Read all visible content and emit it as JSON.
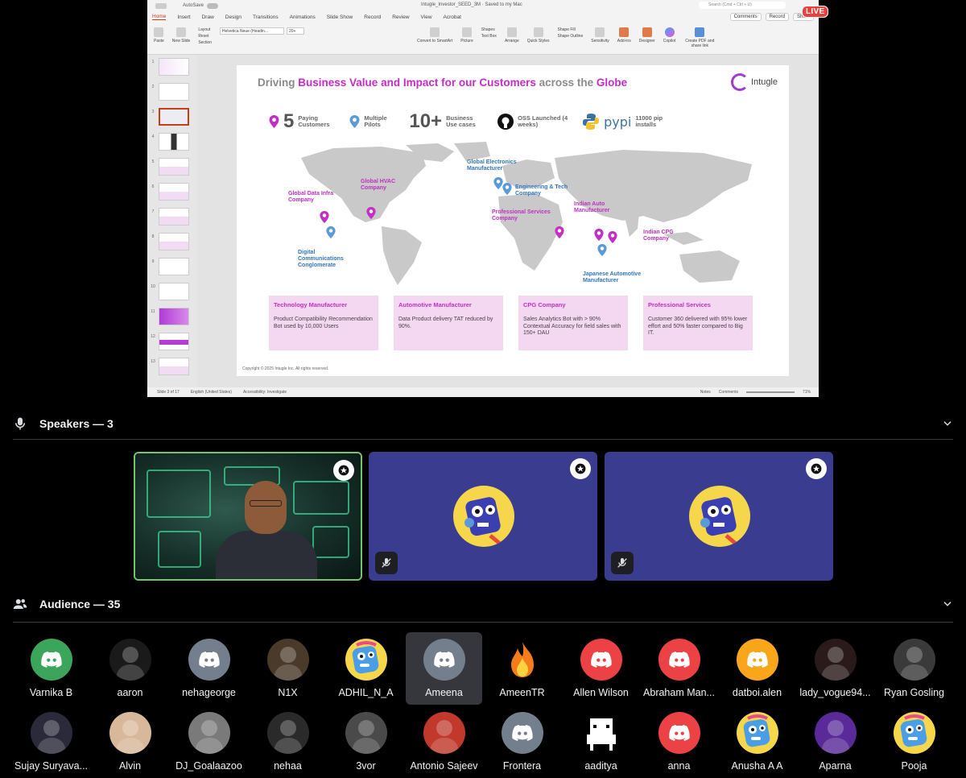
{
  "ppt": {
    "autosave_label": "AutoSave",
    "doc_title": "Intugle_Investor_SEED_3M  ·  Saved to my Mac",
    "search_placeholder": "Search (Cmd + Ctrl + U)",
    "tabs": [
      "Home",
      "Insert",
      "Draw",
      "Design",
      "Transitions",
      "Animations",
      "Slide Show",
      "Record",
      "Review",
      "View",
      "Acrobat"
    ],
    "comments_label": "Comments",
    "record_label": "Record",
    "share_label": "Share",
    "live_label": "LIVE",
    "ribbon": {
      "paste": "Paste",
      "new_slide": "New Slide",
      "layout": "Layout",
      "reset": "Reset",
      "section": "Section",
      "font": "Helvetica Neue (Headin...",
      "font_size": "20+",
      "convert": "Convert to SmartArt",
      "picture": "Picture",
      "shapes": "Shapes",
      "text_box": "Text Box",
      "arrange": "Arrange",
      "quick_styles": "Quick Styles",
      "shape_fill": "Shape Fill",
      "shape_outline": "Shape Outline",
      "sensitivity": "Sensitivity",
      "addins": "Add-ins",
      "designer": "Designer",
      "copilot": "Copilot",
      "create_pdf": "Create PDF and share link"
    },
    "thumb_numbers": [
      "1",
      "2",
      "3",
      "4",
      "5",
      "6",
      "7",
      "8",
      "9",
      "10",
      "11",
      "12",
      "13"
    ],
    "status": {
      "slide": "Slide 3 of 17",
      "language": "English (United States)",
      "accessibility": "Accessibility: Investigate",
      "notes": "Notes",
      "comments": "Comments",
      "zoom": "71%"
    }
  },
  "slide": {
    "headline_parts": [
      "Driving ",
      "Business Value and Impact for our Customers",
      " across the ",
      "Globe"
    ],
    "logo_text": "Intugle",
    "stats": [
      {
        "big": "5",
        "small": "Paying Customers"
      },
      {
        "big": "",
        "small": "Multiple Pilots"
      },
      {
        "big": "10+",
        "small": "Business Use cases"
      },
      {
        "big": "",
        "small": "OSS Launched (4 weeks)"
      },
      {
        "big": "",
        "logo": "pypi",
        "small": "11000 pip installs"
      }
    ],
    "map_labels": {
      "global_data_infra": "Global Data Infra Company",
      "global_hvac": "Global HVAC Company",
      "digital_comm": "Digital Communications Conglomerate",
      "global_electronics": "Global Electronics Manufacturer",
      "engineering_tech": "Engineering & Tech Company",
      "prof_services": "Professional Services Company",
      "indian_auto": "Indian Auto Manufacturer",
      "indian_cpg": "Indian CPG Company",
      "japanese_auto": "Japanese Automotive Manufacturer"
    },
    "cards": [
      {
        "title": "Technology Manufacturer",
        "body": "Product Compatibility Recommendation Bot used by 10,000 Users"
      },
      {
        "title": "Automotive Manufacturer",
        "body": "Data Product delivery TAT reduced by 90%."
      },
      {
        "title": "CPG Company",
        "body": "Sales Analytics Bot with > 90% Contextual Accuracy for field sales with 150+ DAU"
      },
      {
        "title": "Professional Services",
        "body": "Customer 360 delivered with 95% lower effort and 50% faster compared to Big IT."
      }
    ],
    "copyright": "Copyright © 2025 Intugle Inc. All rights reserved."
  },
  "speakers": {
    "header": "Speakers — 3"
  },
  "audience": {
    "header": "Audience — 35",
    "row1": [
      {
        "name": "Varnika B",
        "avatar": "discord",
        "color": "#3ba55c"
      },
      {
        "name": "aaron",
        "avatar": "photo",
        "color": "#1a1a1a"
      },
      {
        "name": "nehageorge",
        "avatar": "discord",
        "color": "#747f8d"
      },
      {
        "name": "N1X",
        "avatar": "photo",
        "color": "#4a3a2a"
      },
      {
        "name": "ADHIL_N_A",
        "avatar": "mascot",
        "color": "#f6d64a"
      },
      {
        "name": "Ameena",
        "avatar": "discord",
        "color": "#747f8d"
      },
      {
        "name": "AmeenTR",
        "avatar": "fire",
        "color": "#000000"
      },
      {
        "name": "Allen Wilson",
        "avatar": "discord",
        "color": "#ed4245"
      },
      {
        "name": "Abraham Man...",
        "avatar": "discord",
        "color": "#ed4245"
      },
      {
        "name": "datboi.alen",
        "avatar": "discord",
        "color": "#faa61a"
      },
      {
        "name": "lady_vogue94...",
        "avatar": "photo",
        "color": "#2a1a1a"
      },
      {
        "name": "Ryan Gosling",
        "avatar": "photo",
        "color": "#3a3a3a"
      }
    ],
    "row2": [
      {
        "name": "Sujay Suryava...",
        "avatar": "photo",
        "color": "#2a2a3a"
      },
      {
        "name": "Alvin",
        "avatar": "photo",
        "color": "#d8b89a"
      },
      {
        "name": "DJ_Goalaazoo",
        "avatar": "photo",
        "color": "#7a7a7a"
      },
      {
        "name": "nehaa",
        "avatar": "photo",
        "color": "#2a2a2a"
      },
      {
        "name": "3vor",
        "avatar": "photo",
        "color": "#4a4a4a"
      },
      {
        "name": "Antonio Sajeev",
        "avatar": "photo",
        "color": "#c0392b"
      },
      {
        "name": "Frontera",
        "avatar": "discord",
        "color": "#747f8d"
      },
      {
        "name": "aaditya",
        "avatar": "pixel",
        "color": "#000000"
      },
      {
        "name": "anna",
        "avatar": "discord",
        "color": "#ed4245"
      },
      {
        "name": "Anusha A A",
        "avatar": "mascot",
        "color": "#f6d64a"
      },
      {
        "name": "Aparna",
        "avatar": "photo",
        "color": "#5a2a9a"
      },
      {
        "name": "Pooja",
        "avatar": "mascot",
        "color": "#f6d64a"
      }
    ]
  }
}
